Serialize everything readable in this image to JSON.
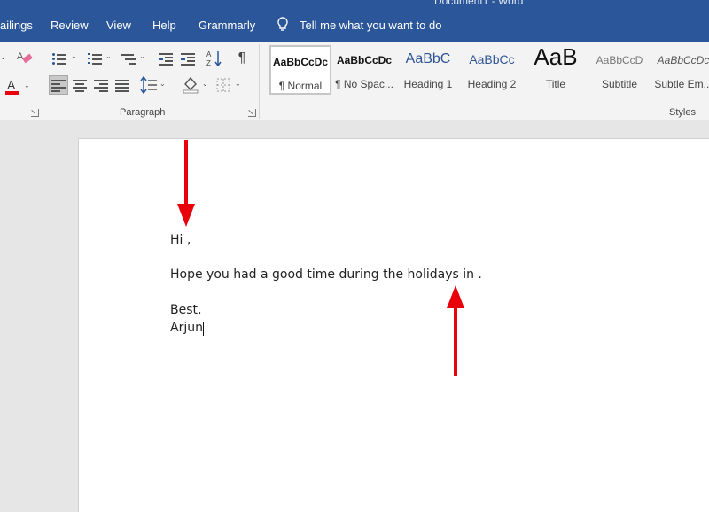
{
  "window": {
    "title": "Document1 - Word"
  },
  "tabs": [
    {
      "label": "ailings"
    },
    {
      "label": "Review"
    },
    {
      "label": "View"
    },
    {
      "label": "Help"
    },
    {
      "label": "Grammarly"
    }
  ],
  "tell_me": {
    "label": "Tell me what you want to do",
    "icon": "lightbulb-icon"
  },
  "ribbon": {
    "paragraph_group_label": "Paragraph",
    "styles_group_label": "Styles",
    "colors": {
      "font_color_accent": "#e8000b"
    },
    "styles": [
      {
        "sample": "AaBbCcDc",
        "name": "¶ Normal",
        "selected": true
      },
      {
        "sample": "AaBbCcDc",
        "name": "¶ No Spac..."
      },
      {
        "sample": "AaBbC",
        "name": "Heading 1"
      },
      {
        "sample": "AaBbCc",
        "name": "Heading 2"
      },
      {
        "sample": "AaB",
        "name": "Title"
      },
      {
        "sample": "AaBbCcD",
        "name": "Subtitle"
      },
      {
        "sample": "AaBbCcDc",
        "name": "Subtle Em..."
      }
    ]
  },
  "document": {
    "greeting": "Hi ,",
    "body": "Hope you had a good time during the holidays in .",
    "closing": "Best,",
    "signature": "Arjun"
  },
  "colors": {
    "title_bar": "#2b579a",
    "annotation_arrow": "#e8000b"
  }
}
